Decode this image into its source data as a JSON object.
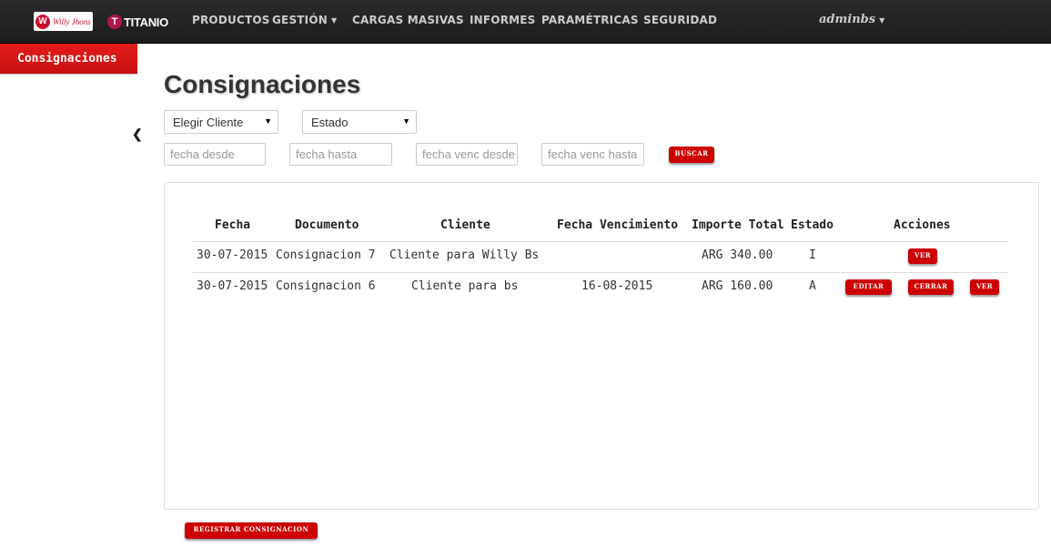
{
  "navbar": {
    "brand_willy": "Willy Jhons",
    "brand_titanio": "TITANIO",
    "items": [
      {
        "label": "PRODUCTOS"
      },
      {
        "label": "GESTIÓN"
      },
      {
        "label": "CARGAS MASIVAS"
      },
      {
        "label": "INFORMES"
      },
      {
        "label": "PARAMÉTRICAS"
      },
      {
        "label": "SEGURIDAD"
      }
    ],
    "user": "adminbs"
  },
  "sidebar": {
    "active_item": "Consignaciones"
  },
  "page": {
    "title": "Consignaciones"
  },
  "filters": {
    "cliente_select": "Elegir Cliente",
    "estado_select": "Estado",
    "fecha_desde_placeholder": "fecha desde",
    "fecha_hasta_placeholder": "fecha hasta",
    "fecha_venc_desde_placeholder": "fecha venc desde",
    "fecha_venc_hasta_placeholder": "fecha venc hasta",
    "buscar_label": "BUSCAR"
  },
  "table": {
    "headers": {
      "fecha": "Fecha",
      "documento": "Documento",
      "cliente": "Cliente",
      "fecha_vencimiento": "Fecha Vencimiento",
      "importe_total": "Importe Total",
      "estado": "Estado",
      "acciones": "Acciones"
    },
    "rows": [
      {
        "fecha": "30-07-2015",
        "documento": "Consignacion 7",
        "cliente": "Cliente para Willy Bs",
        "fecha_vencimiento": "",
        "importe": "ARG 340.00",
        "estado": "I",
        "ver_label": "VER"
      },
      {
        "fecha": "30-07-2015",
        "documento": "Consignacion 6",
        "cliente": "Cliente para bs",
        "fecha_vencimiento": "16-08-2015",
        "importe": "ARG 160.00",
        "estado": "A",
        "editar_label": "EDITAR",
        "cerrar_label": "CERRAR",
        "ver_label": "VER"
      }
    ]
  },
  "footer_actions": {
    "registrar_label": "REGISTRAR CONSIGNACION"
  },
  "colors": {
    "accent_red": "#cc0000",
    "navbar_bg": "#1f1f1f"
  }
}
